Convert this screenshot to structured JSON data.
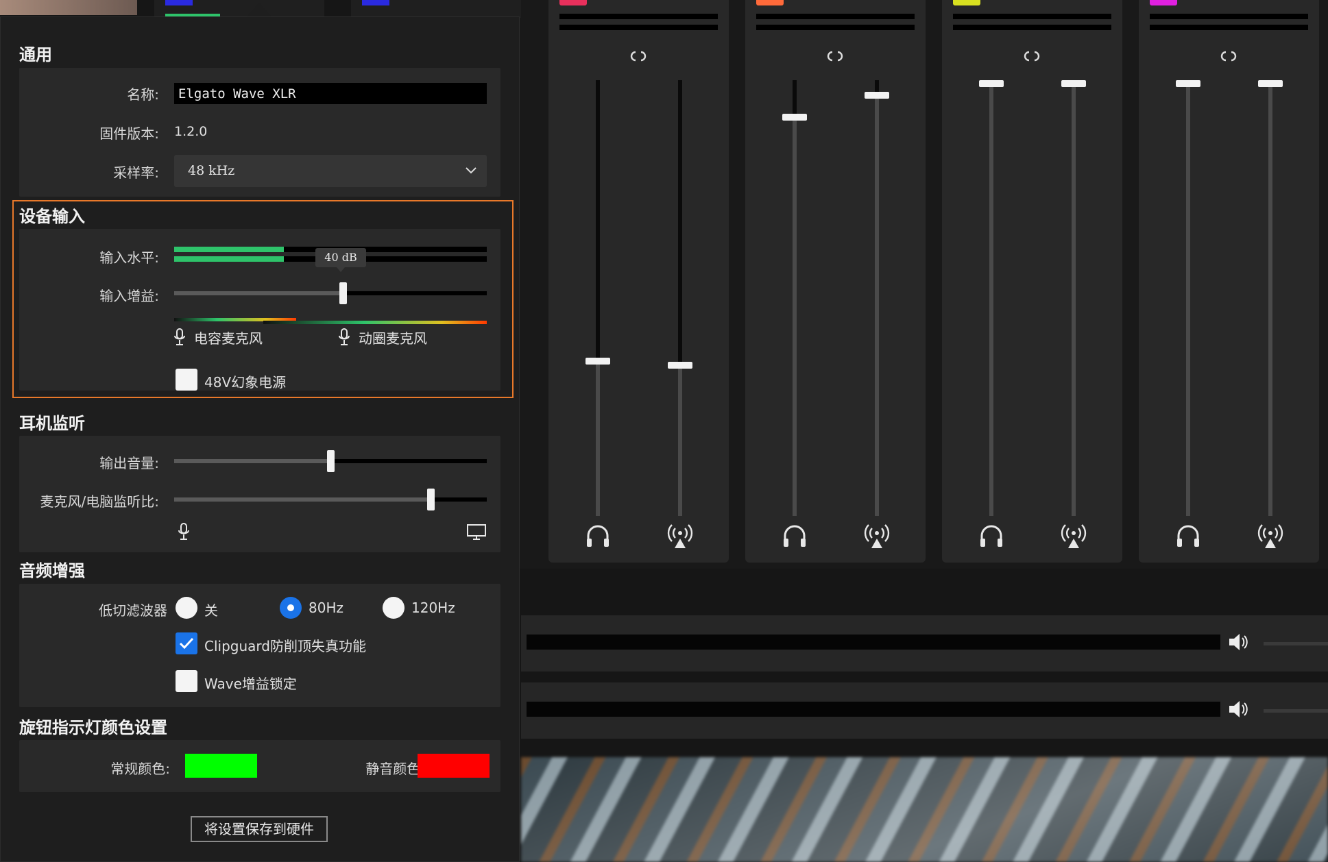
{
  "colors": {
    "accent_blue": "#1a73e8",
    "highlight_orange": "#e8782a",
    "meter_green": "#2ec36a",
    "normal_color": "#00ff00",
    "mute_color": "#ff0000",
    "channel_colors": [
      "#e8305c",
      "#ff6a3a",
      "#d8e020",
      "#e020e0"
    ],
    "top_tab_colors": [
      "#2a2ae0",
      "#2a2ae0"
    ]
  },
  "general": {
    "title": "通用",
    "name_label": "名称:",
    "name_value": "Elgato Wave XLR",
    "firmware_label": "固件版本:",
    "firmware_value": "1.2.0",
    "sample_rate_label": "采样率:",
    "sample_rate_value": "48 kHz"
  },
  "device_input": {
    "title": "设备输入",
    "input_level_label": "输入水平:",
    "input_level_fraction": 0.35,
    "input_gain_label": "输入增益:",
    "input_gain_tooltip": "40 dB",
    "input_gain_fraction": 0.54,
    "condenser_label": "电容麦克风",
    "dynamic_label": "动圈麦克风",
    "phantom_label": "48V幻象电源",
    "phantom_checked": false
  },
  "headphone": {
    "title": "耳机监听",
    "output_volume_label": "输出音量:",
    "output_volume_fraction": 0.5,
    "mix_label": "麦克风/电脑监听比:",
    "mix_fraction": 0.82
  },
  "enhance": {
    "title": "音频增强",
    "lowcut_label": "低切滤波器",
    "options": [
      "关",
      "80Hz",
      "120Hz"
    ],
    "selected_option": "80Hz",
    "clipguard_label": "Clipguard防削顶失真功能",
    "clipguard_checked": true,
    "gainlock_label": "Wave增益锁定",
    "gainlock_checked": false
  },
  "knob": {
    "title": "旋钮指示灯颜色设置",
    "normal_label": "常规颜色:",
    "mute_label": "静音颜色:"
  },
  "save_label": "将设置保存到硬件",
  "icons": {
    "link": "link-icon",
    "headphone": "headphones-icon",
    "stream": "broadcast-icon",
    "mic": "microphone-icon",
    "monitor": "monitor-icon",
    "speaker": "speaker-icon",
    "chevron": "chevron-down-icon"
  },
  "mixer": {
    "channels": [
      {
        "color_index": 0,
        "monitor_level": 0.36,
        "stream_level": 0.35
      },
      {
        "color_index": 1,
        "monitor_level": 0.92,
        "stream_level": 0.97
      },
      {
        "color_index": 2,
        "monitor_level": 1.0,
        "stream_level": 1.0
      },
      {
        "color_index": 3,
        "monitor_level": 1.0,
        "stream_level": 1.0
      }
    ]
  }
}
